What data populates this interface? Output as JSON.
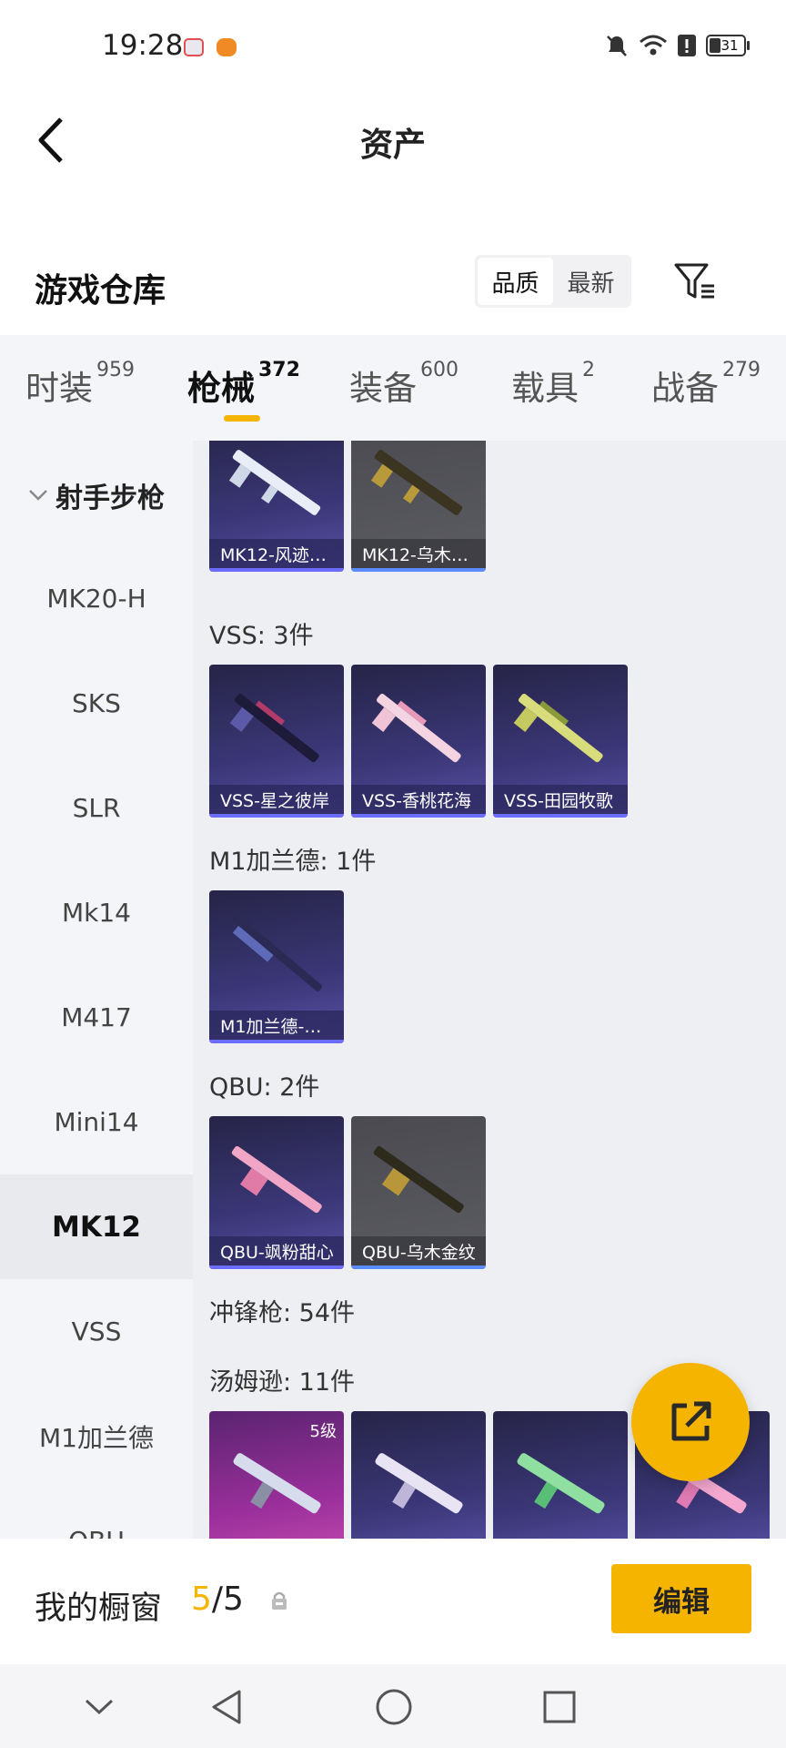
{
  "status_bar": {
    "time": "19:28",
    "battery": "31"
  },
  "header": {
    "title": "资产"
  },
  "section": {
    "title": "游戏仓库",
    "sort_options": [
      "品质",
      "最新"
    ]
  },
  "tabs": [
    {
      "label": "时装",
      "count": "959"
    },
    {
      "label": "枪械",
      "count": "372",
      "active": true
    },
    {
      "label": "装备",
      "count": "600"
    },
    {
      "label": "载具",
      "count": "2"
    },
    {
      "label": "战备",
      "count": "279"
    }
  ],
  "sidebar": {
    "group": "射手步枪",
    "items": [
      "MK20-H",
      "SKS",
      "SLR",
      "Mk14",
      "M417",
      "Mini14",
      "MK12",
      "VSS",
      "M1加兰德",
      "QBU"
    ],
    "active": "MK12"
  },
  "content": {
    "mk12_cards": [
      {
        "name": "MK12-风迹…",
        "style": "purple"
      },
      {
        "name": "MK12-乌木…",
        "style": "grey"
      }
    ],
    "groups": [
      {
        "label": "VSS: 3件",
        "cards": [
          {
            "name": "VSS-星之彼岸",
            "style": "purple"
          },
          {
            "name": "VSS-香桃花海",
            "style": "purple"
          },
          {
            "name": "VSS-田园牧歌",
            "style": "purple"
          }
        ]
      },
      {
        "label": "M1加兰德: 1件",
        "cards": [
          {
            "name": "M1加兰德-…",
            "style": "purple"
          }
        ]
      },
      {
        "label": "QBU: 2件",
        "cards": [
          {
            "name": "QBU-飒粉甜心",
            "style": "purple"
          },
          {
            "name": "QBU-乌木金纹",
            "style": "grey"
          }
        ]
      },
      {
        "label": "冲锋枪: 54件",
        "cards": []
      },
      {
        "label": "汤姆逊: 11件",
        "cards": [
          {
            "level": "5级",
            "style": "magenta"
          },
          {
            "style": "purple"
          },
          {
            "style": "purple"
          },
          {
            "style": "purple"
          }
        ]
      }
    ]
  },
  "bottom": {
    "showcase_label": "我的橱窗",
    "current": "5",
    "total": "/5",
    "edit_label": "编辑"
  },
  "colors": {
    "accent": "#f5b400",
    "card_purple": "#3b3778",
    "card_grey": "#5c5c63"
  }
}
